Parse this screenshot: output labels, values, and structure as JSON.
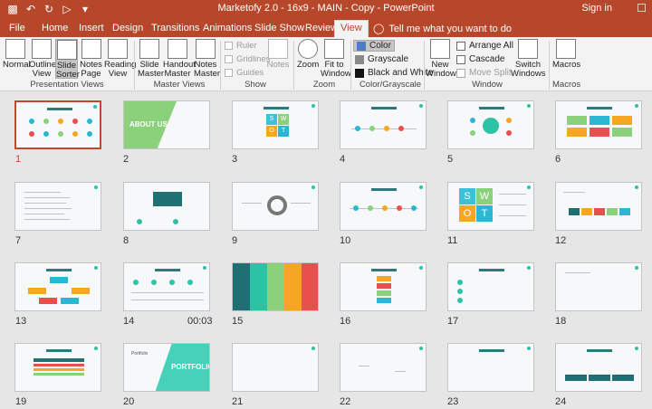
{
  "titlebar": {
    "title": "Marketofy 2.0 - 16x9 - MAIN - Copy  -  PowerPoint",
    "signin": "Sign in",
    "window_controls": "☐"
  },
  "qat": {
    "save_icon": "save-icon",
    "undo_glyph": "↶",
    "redo_glyph": "↻",
    "start_glyph": "▷",
    "more_glyph": "▾"
  },
  "tabs": [
    "File",
    "Home",
    "Insert",
    "Design",
    "Transitions",
    "Animations",
    "Slide Show",
    "Review",
    "View"
  ],
  "active_tab": "View",
  "tell_me": "Tell me what you want to do",
  "ribbon": {
    "presentation_views": {
      "label": "Presentation Views",
      "buttons": [
        "Normal",
        "Outline View",
        "Slide Sorter",
        "Notes Page",
        "Reading View"
      ],
      "selected": "Slide Sorter"
    },
    "master_views": {
      "label": "Master Views",
      "buttons": [
        "Slide Master",
        "Handout Master",
        "Notes Master"
      ]
    },
    "show": {
      "label": "Show",
      "checks": [
        "Ruler",
        "Gridlines",
        "Guides"
      ],
      "notes": "Notes"
    },
    "zoom": {
      "label": "Zoom",
      "buttons": [
        "Zoom",
        "Fit to Window"
      ]
    },
    "color_grayscale": {
      "label": "Color/Grayscale",
      "items": [
        "Color",
        "Grayscale",
        "Black and White"
      ],
      "selected": "Color"
    },
    "window": {
      "label": "Window",
      "new_window": "New Window",
      "items": [
        "Arrange All",
        "Cascade",
        "Move Split"
      ],
      "switch": "Switch Windows"
    },
    "macros": {
      "label": "Macros",
      "button": "Macros"
    }
  },
  "slides": [
    {
      "n": "1"
    },
    {
      "n": "2"
    },
    {
      "n": "3"
    },
    {
      "n": "4"
    },
    {
      "n": "5"
    },
    {
      "n": "6"
    },
    {
      "n": "7"
    },
    {
      "n": "8"
    },
    {
      "n": "9"
    },
    {
      "n": "10"
    },
    {
      "n": "11"
    },
    {
      "n": "12"
    },
    {
      "n": "13"
    },
    {
      "n": "14"
    },
    {
      "n": "15"
    },
    {
      "n": "16"
    },
    {
      "n": "17"
    },
    {
      "n": "18"
    },
    {
      "n": "19"
    },
    {
      "n": "20"
    },
    {
      "n": "21"
    },
    {
      "n": "22"
    },
    {
      "n": "23"
    },
    {
      "n": "24"
    }
  ],
  "selected_slide": "1",
  "slide14_timing": "00:03",
  "slide_text": {
    "s2": "ABOUT US",
    "s3": [
      "S",
      "W",
      "O",
      "T"
    ],
    "s11": [
      "S",
      "W",
      "O",
      "T"
    ],
    "s20": "PORTFOLIO",
    "s20_small": "Portfolio"
  },
  "colors": {
    "accent": "#b7472a",
    "selected_border": "#c4462c",
    "teal": "#2c7a7b",
    "green": "#8bd17c",
    "swot_s": "#3cc2d8",
    "swot_w": "#8bd17c",
    "swot_o": "#f6a623",
    "swot_t": "#2bb6d2"
  }
}
